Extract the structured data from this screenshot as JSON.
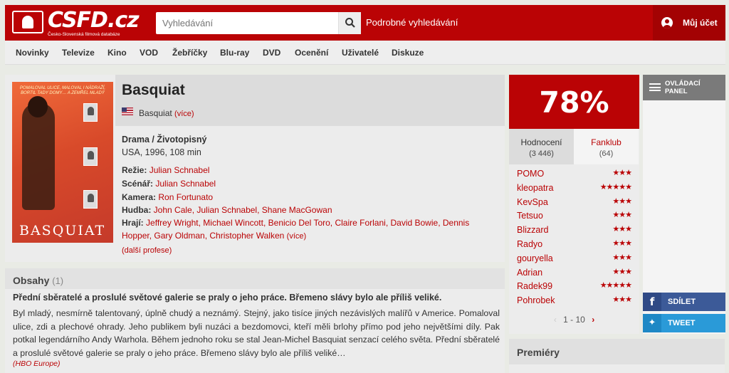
{
  "header": {
    "logo_text": "CSFD.cz",
    "logo_subtitle": "Česko-Slovenská filmová databáze",
    "search_placeholder": "Vyhledávání",
    "advanced_search": "Podrobné vyhledávání",
    "account": "Můj účet",
    "colors": {
      "brand": "#ba0305"
    }
  },
  "nav": [
    "Novinky",
    "Televize",
    "Kino",
    "VOD",
    "Žebříčky",
    "Blu-ray",
    "DVD",
    "Ocenění",
    "Uživatelé",
    "Diskuze"
  ],
  "film": {
    "title": "Basquiat",
    "alt_title": "Basquiat",
    "alt_more": "(více)",
    "genres": "Drama / Životopisný",
    "origin": "USA, 1996, 108 min",
    "poster_title": "BASQUIAT",
    "poster_tagline": "POMALOVAL ULICE, MALOVAL I NÁDRAŽÍ, BORTIL TADY DOMY… A ZEMŘEL MLADÝ",
    "crew": {
      "director_label": "Režie:",
      "director": "Julian Schnabel",
      "writer_label": "Scénář:",
      "writer": "Julian Schnabel",
      "camera_label": "Kamera:",
      "camera": "Ron Fortunato",
      "music_label": "Hudba:",
      "music": "John Cale, Julian Schnabel, Shane MacGowan",
      "cast_label": "Hrají:",
      "cast_line1": "Jeffrey Wright, Michael Wincott, Benicio Del Toro, Claire Forlani, David Bowie, Dennis",
      "cast_line2": "Hopper, Gary Oldman, Christopher Walken",
      "cast_more": "(více)",
      "more_professions": "(další profese)"
    }
  },
  "plot": {
    "title": "Obsahy",
    "count": "(1)",
    "lead": "Přední sběratelé a proslulé světové galerie se praly o jeho práce. Břemeno slávy bylo ale příliš veliké.",
    "text": "Byl mladý, nesmírně talentovaný, úplně chudý a neznámý. Stejný, jako tisíce jiných nezávislých malířů v Americe. Pomaloval ulice, zdi a plechové ohrady. Jeho publikem byli nuzáci a bezdomovci, kteří měli brlohy přímo pod jeho největšími díly. Pak potkal legendárního Andy Warhola. Během jednoho roku se stal Jean-Michel Basquiat senzací celého světa. Přední sběratelé a proslulé světové galerie se praly o jeho práce. Břemeno slávy bylo ale příliš veliké…",
    "source": "(HBO Europe)"
  },
  "rating": {
    "percent": "78%",
    "tab_ratings": "Hodnocení",
    "tab_ratings_count": "(3 446)",
    "tab_fanclub": "Fanklub",
    "tab_fanclub_count": "(64)",
    "users": [
      {
        "name": "POMO",
        "stars": "★★★"
      },
      {
        "name": "kleopatra",
        "stars": "★★★★★"
      },
      {
        "name": "KevSpa",
        "stars": "★★★"
      },
      {
        "name": "Tetsuo",
        "stars": "★★★"
      },
      {
        "name": "Blizzard",
        "stars": "★★★"
      },
      {
        "name": "Radyo",
        "stars": "★★★"
      },
      {
        "name": "gouryella",
        "stars": "★★★"
      },
      {
        "name": "Adrian",
        "stars": "★★★"
      },
      {
        "name": "Radek99",
        "stars": "★★★★★"
      },
      {
        "name": "Pohrobek",
        "stars": "★★★"
      }
    ],
    "pager": "1 - 10"
  },
  "premiery": {
    "title": "Premiéry"
  },
  "side": {
    "panel": "OVLÁDACÍ PANEL",
    "share": "SDÍLET",
    "tweet": "TWEET"
  }
}
